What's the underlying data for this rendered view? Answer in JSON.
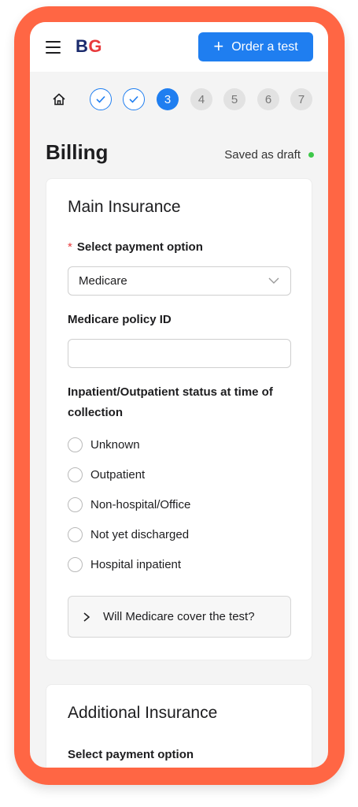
{
  "header": {
    "logo_b": "B",
    "logo_g": "G",
    "order_button_label": "Order a test"
  },
  "stepper": {
    "steps": [
      {
        "label": "",
        "state": "done"
      },
      {
        "label": "",
        "state": "done"
      },
      {
        "label": "3",
        "state": "current"
      },
      {
        "label": "4",
        "state": "todo"
      },
      {
        "label": "5",
        "state": "todo"
      },
      {
        "label": "6",
        "state": "todo"
      },
      {
        "label": "7",
        "state": "todo"
      }
    ]
  },
  "page": {
    "title": "Billing",
    "draft_status": "Saved as draft"
  },
  "main_insurance": {
    "title": "Main Insurance",
    "payment_label": "Select payment option",
    "required_marker": "*",
    "payment_value": "Medicare",
    "policy_label": "Medicare policy ID",
    "policy_value": "",
    "status_label_line1": "Inpatient/Outpatient status at time of",
    "status_label_line2": "collection",
    "status_options": [
      "Unknown",
      "Outpatient",
      "Non-hospital/Office",
      "Not yet discharged",
      "Hospital inpatient"
    ],
    "accordion_label": "Will Medicare cover the test?"
  },
  "additional_insurance": {
    "title": "Additional Insurance",
    "payment_label": "Select payment option"
  },
  "colors": {
    "frame": "#ff6644",
    "accent": "#1f7ef0",
    "required": "#e8393b",
    "draft_dot": "#3ec84a"
  }
}
